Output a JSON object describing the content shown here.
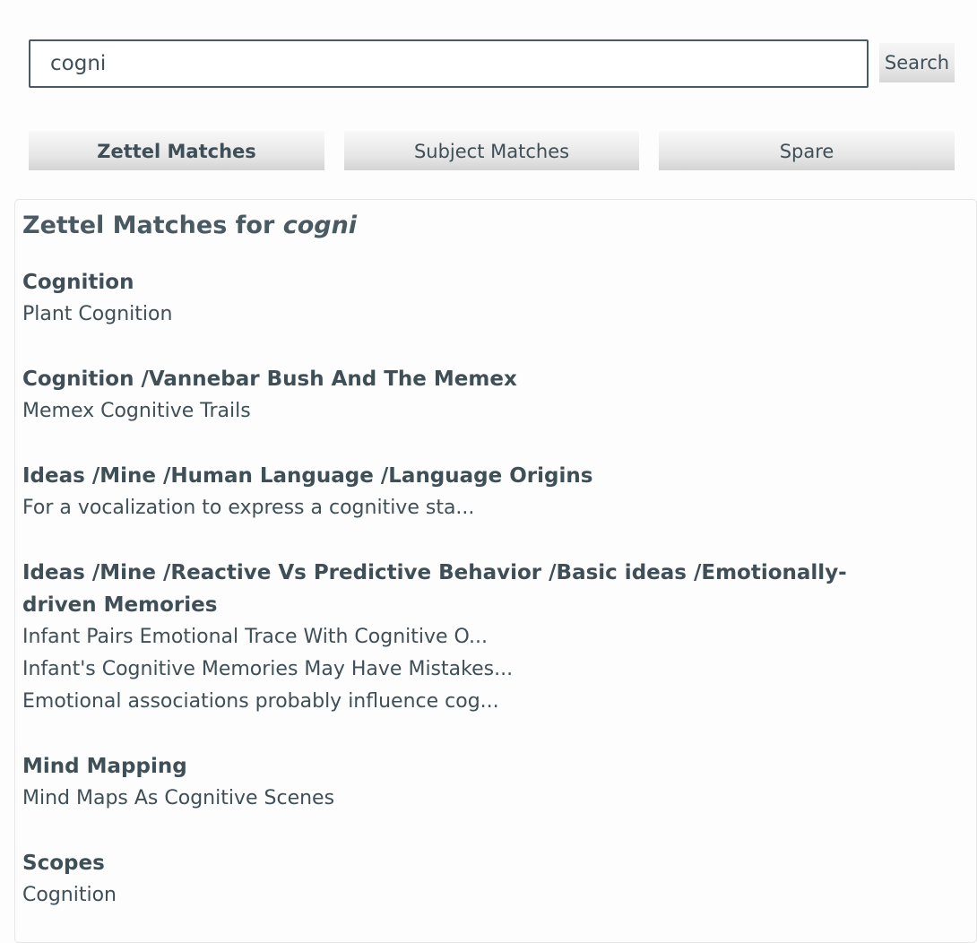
{
  "search": {
    "value": "cogni",
    "button_label": "Search"
  },
  "tabs": [
    {
      "label": "Zettel Matches",
      "active": true
    },
    {
      "label": "Subject Matches",
      "active": false
    },
    {
      "label": "Spare",
      "active": false
    }
  ],
  "results": {
    "title_prefix": "Zettel Matches for ",
    "title_query": "cogni",
    "groups": [
      {
        "subject": "Cognition",
        "items": [
          "Plant Cognition"
        ]
      },
      {
        "subject": "Cognition /Vannebar Bush And The Memex",
        "items": [
          "Memex Cognitive Trails"
        ]
      },
      {
        "subject": "Ideas /Mine /Human Language /Language Origins",
        "items": [
          "For a vocalization to express a cognitive sta..."
        ]
      },
      {
        "subject": "Ideas /Mine /Reactive Vs Predictive Behavior /Basic ideas /Emotionally-driven Memories",
        "items": [
          "Infant Pairs Emotional Trace With Cognitive O...",
          "Infant's Cognitive Memories May Have Mistakes...",
          "Emotional associations probably influence cog..."
        ]
      },
      {
        "subject": "Mind Mapping",
        "items": [
          "Mind Maps As Cognitive Scenes"
        ]
      },
      {
        "subject": "Scopes",
        "items": [
          "Cognition"
        ]
      }
    ]
  }
}
